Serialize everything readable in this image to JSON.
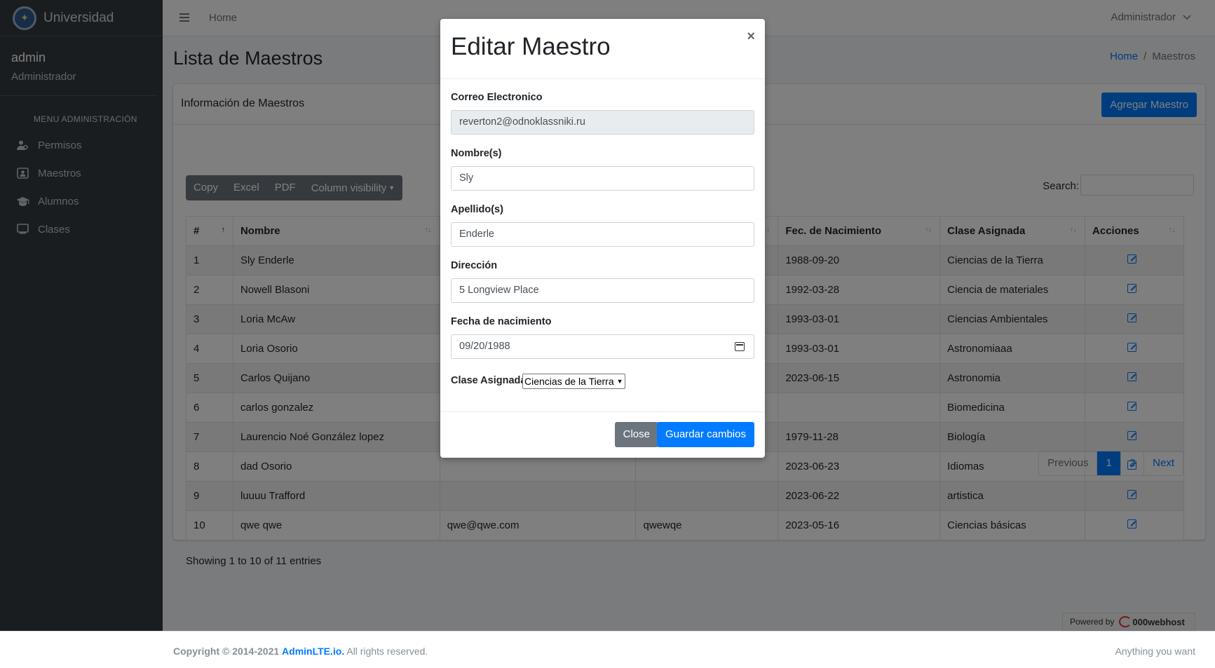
{
  "brand": {
    "name": "Universidad"
  },
  "user": {
    "name": "admin",
    "role": "Administrador"
  },
  "sidebar": {
    "header": "MENU ADMINISTRACIÓN",
    "items": [
      {
        "label": "Permisos",
        "icon": "users-icon"
      },
      {
        "label": "Maestros",
        "icon": "id-badge-icon"
      },
      {
        "label": "Alumnos",
        "icon": "graduation-cap-icon"
      },
      {
        "label": "Clases",
        "icon": "chalkboard-icon"
      }
    ]
  },
  "topbar": {
    "home": "Home",
    "user_menu": "Administrador"
  },
  "page": {
    "title": "Lista de Maestros",
    "breadcrumb": {
      "home": "Home",
      "separator": "/",
      "current": "Maestros"
    }
  },
  "card": {
    "title": "Información de Maestros",
    "add_button": "Agregar Maestro",
    "buttons": [
      "Copy",
      "Excel",
      "PDF",
      "Column visibility"
    ],
    "search_label": "Search:"
  },
  "table": {
    "headers": [
      "#",
      "Nombre",
      "",
      "",
      "Fec. de Nacimiento",
      "Clase Asignada",
      "Acciones"
    ],
    "rows": [
      {
        "num": "1",
        "nombre": "Sly Enderle",
        "email": "",
        "direccion": "",
        "fecha": "1988-09-20",
        "clase": "Ciencias de la Tierra"
      },
      {
        "num": "2",
        "nombre": "Nowell Blasoni",
        "email": "",
        "direccion": "",
        "fecha": "1992-03-28",
        "clase": "Ciencia de materiales"
      },
      {
        "num": "3",
        "nombre": "Loria McAw",
        "email": "",
        "direccion": "",
        "fecha": "1993-03-01",
        "clase": "Ciencias Ambientales"
      },
      {
        "num": "4",
        "nombre": "Loria Osorio",
        "email": "",
        "direccion": "",
        "fecha": "1993-03-01",
        "clase": "Astronomiaaa"
      },
      {
        "num": "5",
        "nombre": "Carlos Quijano",
        "email": "",
        "direccion": "",
        "fecha": "2023-06-15",
        "clase": "Astronomia"
      },
      {
        "num": "6",
        "nombre": "carlos gonzalez",
        "email": "",
        "direccion": "",
        "fecha": "",
        "clase": "Biomedicina"
      },
      {
        "num": "7",
        "nombre": "Laurencio Noé González lopez",
        "email": "",
        "direccion": "",
        "fecha": "1979-11-28",
        "clase": "Biología"
      },
      {
        "num": "8",
        "nombre": "dad Osorio",
        "email": "",
        "direccion": "",
        "fecha": "2023-06-23",
        "clase": "Idiomas"
      },
      {
        "num": "9",
        "nombre": "luuuu Trafford",
        "email": "",
        "direccion": "",
        "fecha": "2023-06-22",
        "clase": "artistica"
      },
      {
        "num": "10",
        "nombre": "qwe qwe",
        "email": "qwe@qwe.com",
        "direccion": "qwewqe",
        "fecha": "2023-05-16",
        "clase": "Ciencias básicas"
      }
    ],
    "info": "Showing 1 to 10 of 11 entries",
    "pagination": [
      "Previous",
      "1",
      "2",
      "Next"
    ]
  },
  "modal": {
    "title": "Editar Maestro",
    "close_symbol": "×",
    "fields": {
      "email_label": "Correo Electronico",
      "email_value": "reverton2@odnoklassniki.ru",
      "nombre_label": "Nombre(s)",
      "nombre_value": "Sly",
      "apellido_label": "Apellido(s)",
      "apellido_value": "Enderle",
      "direccion_label": "Dirección",
      "direccion_value": "5 Longview Place",
      "fecha_label": "Fecha de nacimiento",
      "fecha_value": "09/20/1988",
      "clase_label": "Clase Asignada",
      "clase_value": "Ciencias de la Tierra"
    },
    "close_button": "Close",
    "save_button": "Guardar cambios"
  },
  "powered": {
    "prefix": "Powered by",
    "name": "000webhost"
  },
  "footer": {
    "copyright": "Copyright © 2014-2021",
    "link": "AdminLTE.io.",
    "rights": "All rights reserved.",
    "right": "Anything you want"
  },
  "colors": {
    "primary": "#007bff",
    "sidebar": "#343a40",
    "secondary": "#6c757d"
  }
}
